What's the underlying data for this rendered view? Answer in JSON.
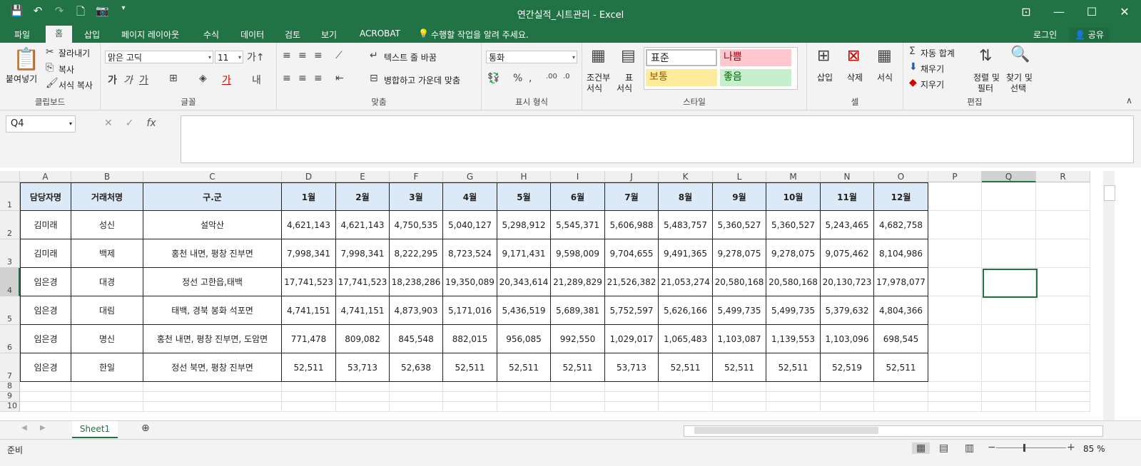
{
  "window": {
    "title": "연간실적_시트관리 - Excel"
  },
  "tabs": [
    "파일",
    "홈",
    "삽입",
    "페이지 레이아웃",
    "수식",
    "데이터",
    "검토",
    "보기",
    "ACROBAT"
  ],
  "tell_me": "수행할 작업을 알려 주세요.",
  "login": "로그인",
  "share": "공유",
  "ribbon": {
    "paste": "붙여넣기",
    "cut": "잘라내기",
    "copy": "복사",
    "format_painter": "서식 복사",
    "clipboard": "클립보드",
    "font_name": "맑은 고딕",
    "font_size": "11",
    "font_group": "글꼴",
    "wrap_text": "텍스트 줄 바꿈",
    "merge_center": "병합하고 가운데 맞춤",
    "alignment": "맞춤",
    "number_format": "통화",
    "number_group": "표시 형식",
    "conditional": "조건부",
    "conditional2": "서식",
    "table": "표",
    "table2": "서식",
    "style_normal": "표준",
    "style_bad": "나쁨",
    "style_neutral": "보통",
    "style_good": "좋음",
    "styles": "스타일",
    "insert": "삽입",
    "delete": "삭제",
    "format": "서식",
    "cells": "셀",
    "autosum": "자동 합계",
    "fill": "채우기",
    "clear": "지우기",
    "sort": "정렬 및",
    "sort2": "필터",
    "find": "찾기 및",
    "find2": "선택",
    "editing": "편집"
  },
  "name_box": "Q4",
  "columns": [
    "A",
    "B",
    "C",
    "D",
    "E",
    "F",
    "G",
    "H",
    "I",
    "J",
    "K",
    "L",
    "M",
    "N",
    "O",
    "P",
    "Q",
    "R"
  ],
  "rows": [
    "1",
    "2",
    "3",
    "4",
    "5",
    "6",
    "7",
    "8",
    "9",
    "10"
  ],
  "table": {
    "header": [
      "담당자명",
      "거래처명",
      "구.군",
      "1월",
      "2월",
      "3월",
      "4월",
      "5월",
      "6월",
      "7월",
      "8월",
      "9월",
      "10월",
      "11월",
      "12월"
    ],
    "rows": [
      [
        "김미래",
        "성신",
        "설악산",
        "4,621,143",
        "4,621,143",
        "4,750,535",
        "5,040,127",
        "5,298,912",
        "5,545,371",
        "5,606,988",
        "5,483,757",
        "5,360,527",
        "5,360,527",
        "5,243,465",
        "4,682,758"
      ],
      [
        "김미래",
        "백제",
        "홍천 내면, 평창 진부면",
        "7,998,341",
        "7,998,341",
        "8,222,295",
        "8,723,524",
        "9,171,431",
        "9,598,009",
        "9,704,655",
        "9,491,365",
        "9,278,075",
        "9,278,075",
        "9,075,462",
        "8,104,986"
      ],
      [
        "임은경",
        "대경",
        "정선 고한읍,태백",
        "17,741,523",
        "17,741,523",
        "18,238,286",
        "19,350,089",
        "20,343,614",
        "21,289,829",
        "21,526,382",
        "21,053,274",
        "20,580,168",
        "20,580,168",
        "20,130,723",
        "17,978,077"
      ],
      [
        "임은경",
        "대림",
        "태백, 경북 봉화 석포면",
        "4,741,151",
        "4,741,151",
        "4,873,903",
        "5,171,016",
        "5,436,519",
        "5,689,381",
        "5,752,597",
        "5,626,166",
        "5,499,735",
        "5,499,735",
        "5,379,632",
        "4,804,366"
      ],
      [
        "임은경",
        "명신",
        "홍천 내면, 평창 진부면, 도암면",
        "771,478",
        "809,082",
        "845,548",
        "882,015",
        "956,085",
        "992,550",
        "1,029,017",
        "1,065,483",
        "1,103,087",
        "1,139,553",
        "1,103,096",
        "698,545"
      ],
      [
        "임은경",
        "한일",
        "정선 북면, 평창 진부면",
        "52,511",
        "53,713",
        "52,638",
        "52,511",
        "52,511",
        "52,511",
        "53,713",
        "52,511",
        "52,511",
        "52,511",
        "52,519",
        "52,511"
      ]
    ]
  },
  "sheet_tab": "Sheet1",
  "status": "준비",
  "zoom": "85 %"
}
